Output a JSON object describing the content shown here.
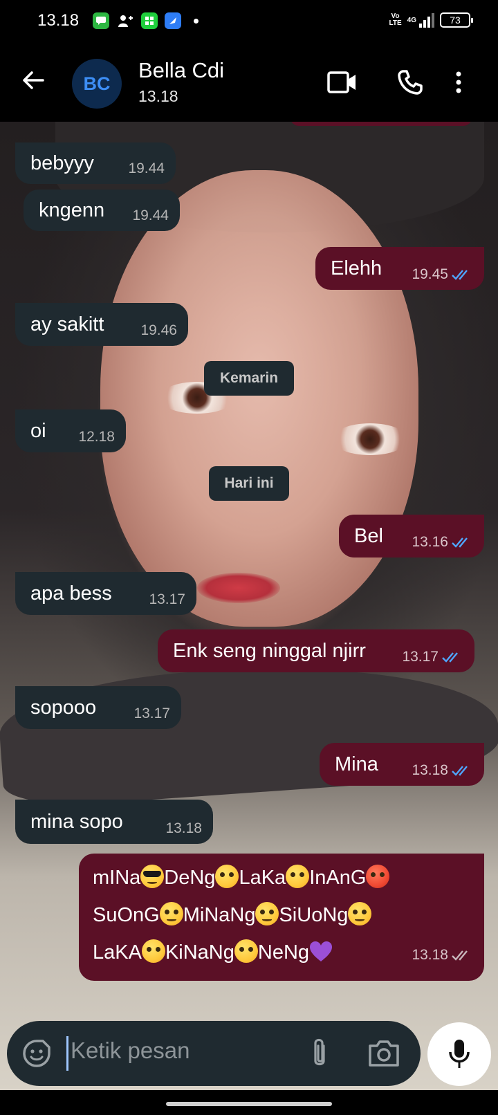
{
  "status_bar": {
    "time": "13.18",
    "network": "4G",
    "volte": "Vo LTE",
    "battery": "73"
  },
  "header": {
    "avatar_initials": "BC",
    "contact_name": "Bella Cdi",
    "last_seen": "13.18"
  },
  "messages": [
    {
      "dir": "in",
      "text": "bebyyy",
      "time": "19.44"
    },
    {
      "dir": "in",
      "text": "kngenn",
      "time": "19.44"
    },
    {
      "dir": "out",
      "text": "Elehh",
      "time": "19.45",
      "read": true
    },
    {
      "dir": "in",
      "text": "ay sakitt",
      "time": "19.46"
    },
    {
      "type": "date",
      "text": "Kemarin"
    },
    {
      "dir": "in",
      "text": "oi",
      "time": "12.18"
    },
    {
      "type": "date",
      "text": "Hari ini"
    },
    {
      "dir": "out",
      "text": "Bel",
      "time": "13.16",
      "read": true
    },
    {
      "dir": "in",
      "text": "apa bess",
      "time": "13.17"
    },
    {
      "dir": "out",
      "text": "Enk seng ninggal njirr",
      "time": "13.17",
      "read": true
    },
    {
      "dir": "in",
      "text": "sopooo",
      "time": "13.17"
    },
    {
      "dir": "out",
      "text": "Mina",
      "time": "13.18",
      "read": true
    },
    {
      "dir": "in",
      "text": "mina sopo",
      "time": "13.18"
    },
    {
      "dir": "out",
      "time": "13.18",
      "read": false,
      "segments": [
        "mINa",
        "DeNg",
        "LaKa",
        "InAnG",
        "SuOnG",
        "MiNaNg",
        "SiUoNg",
        "LaKA",
        "KiNaNg",
        "NeNg"
      ]
    }
  ],
  "input": {
    "placeholder": "Ketik pesan"
  },
  "colors": {
    "incoming_bubble": "#1f2a30",
    "outgoing_bubble": "#5b1026",
    "read_ticks": "#4fa6ff",
    "avatar_bg": "#0d2a4e",
    "avatar_text": "#3d8ef5"
  },
  "icons": {
    "back": "arrow-left-icon",
    "video": "video-camera-icon",
    "call": "phone-icon",
    "menu": "more-vertical-icon",
    "emoji": "emoji-icon",
    "attach": "paperclip-icon",
    "camera": "camera-icon",
    "mic": "microphone-icon"
  }
}
